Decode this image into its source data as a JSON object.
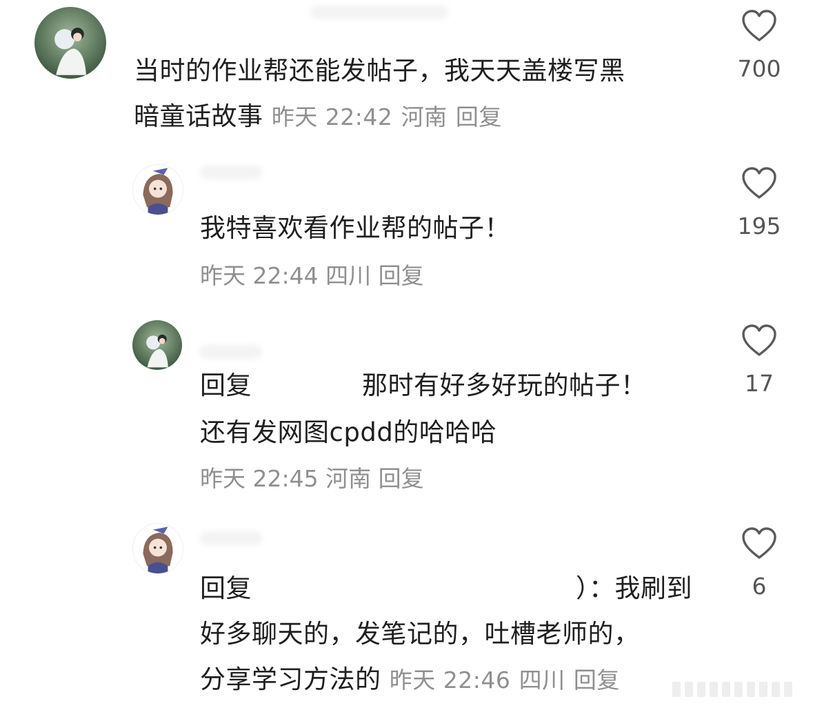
{
  "comments": [
    {
      "text_line1": "当时的作业帮还能发帖子，我天天盖楼写黑",
      "text_line2": "暗童话故事",
      "time": "昨天 22:42",
      "location": "河南",
      "reply_label": "回复",
      "likes": "700"
    },
    {
      "text": "我特喜欢看作业帮的帖子！",
      "time": "昨天 22:44",
      "location": "四川",
      "reply_label": "回复",
      "likes": "195"
    },
    {
      "reply_prefix": "回复",
      "text_line1": "那时有好多好玩的帖子！",
      "text_line2": "还有发网图cpdd的哈哈哈",
      "time": "昨天 22:45",
      "location": "河南",
      "reply_label": "回复",
      "likes": "17"
    },
    {
      "reply_prefix": "回复",
      "text_line1_tail": "）：我刷到",
      "text_line2": "好多聊天的，发笔记的，吐槽老师的，",
      "text_line3": "分享学习方法的",
      "time": "昨天 22:46",
      "location": "四川",
      "reply_label": "回复",
      "likes": "6"
    }
  ],
  "icons": {
    "like": "heart-outline-icon"
  },
  "colors": {
    "text": "#1f1f1f",
    "meta": "#8f8f8f",
    "like_count": "#555555"
  }
}
